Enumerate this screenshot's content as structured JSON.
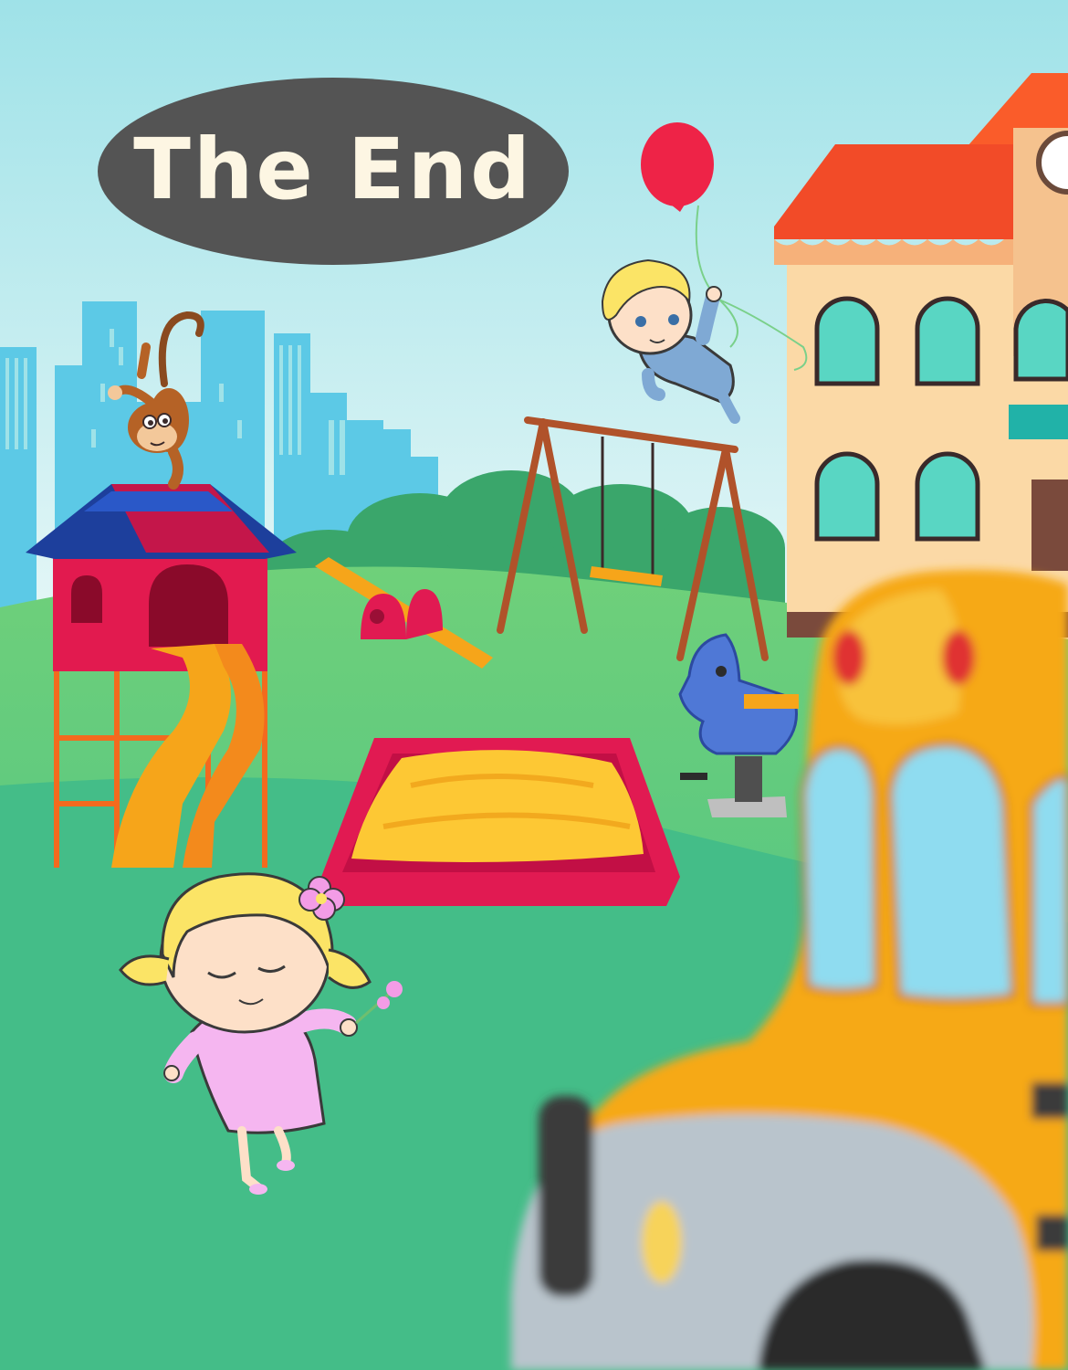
{
  "title": {
    "text": "The End"
  },
  "colors": {
    "sky_top": "#a2e3e8",
    "sky_bottom": "#e3f6f7",
    "grass": "#47bf85",
    "grass_light": "#6fd07a",
    "title_bg": "#545454",
    "title_text": "#fdf6e3",
    "bus": "#f6a917",
    "roof_tiles": "#fa5c2a",
    "school_wall": "#fbd9a6"
  },
  "icons": [
    "city-skyline",
    "bushes",
    "playhouse-with-slide",
    "monkey",
    "seesaw",
    "swing-set",
    "spring-horse",
    "sandbox",
    "school-building",
    "red-balloon",
    "boy-floating",
    "girl-with-flower",
    "school-bus"
  ]
}
